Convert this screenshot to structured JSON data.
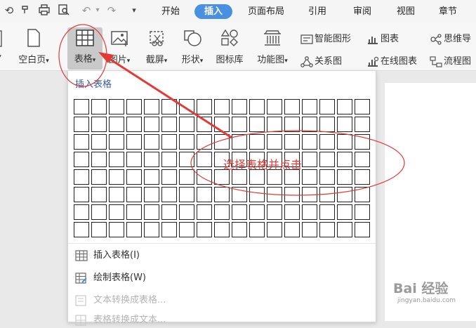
{
  "quick_access": {
    "icons": [
      "undo-history-icon",
      "format-painter-icon",
      "print-icon",
      "print-preview-icon",
      "undo-icon",
      "redo-icon",
      "customize-dropdown-icon"
    ]
  },
  "tabs": [
    "开始",
    "插入",
    "页面布局",
    "引用",
    "审阅",
    "视图",
    "章节"
  ],
  "active_tab": "插入",
  "ribbon": {
    "blank_page": "空白页",
    "table": "表格",
    "picture": "图片",
    "screenshot": "截屏",
    "shape": "形状",
    "icon_library": "图标库",
    "function_chart": "功能图",
    "smart_graphic": "智能图形",
    "chart": "图表",
    "qr_code": "思维导",
    "relation_chart": "关系图",
    "online_chart": "在线图表",
    "flowchart": "流程图"
  },
  "dropdown": {
    "title": "插入表格",
    "grid_rows": 8,
    "grid_cols": 17,
    "menu": [
      {
        "label": "插入表格(I)",
        "enabled": true
      },
      {
        "label": "绘制表格(W)",
        "enabled": true
      },
      {
        "label": "文本转换成表格...",
        "enabled": false
      },
      {
        "label": "表格转换成文本...",
        "enabled": false
      }
    ]
  },
  "annotation": {
    "text": "选择表格并点击",
    "color": "#e53935"
  },
  "watermark": {
    "logo": "Bai 经验",
    "url": "jingyan.baidu.com"
  },
  "colors": {
    "accent_tab": "#4a90e2",
    "selected_button": "#c9c9c9",
    "dropdown_title": "#3a5ea8",
    "annotation": "#e53935"
  }
}
